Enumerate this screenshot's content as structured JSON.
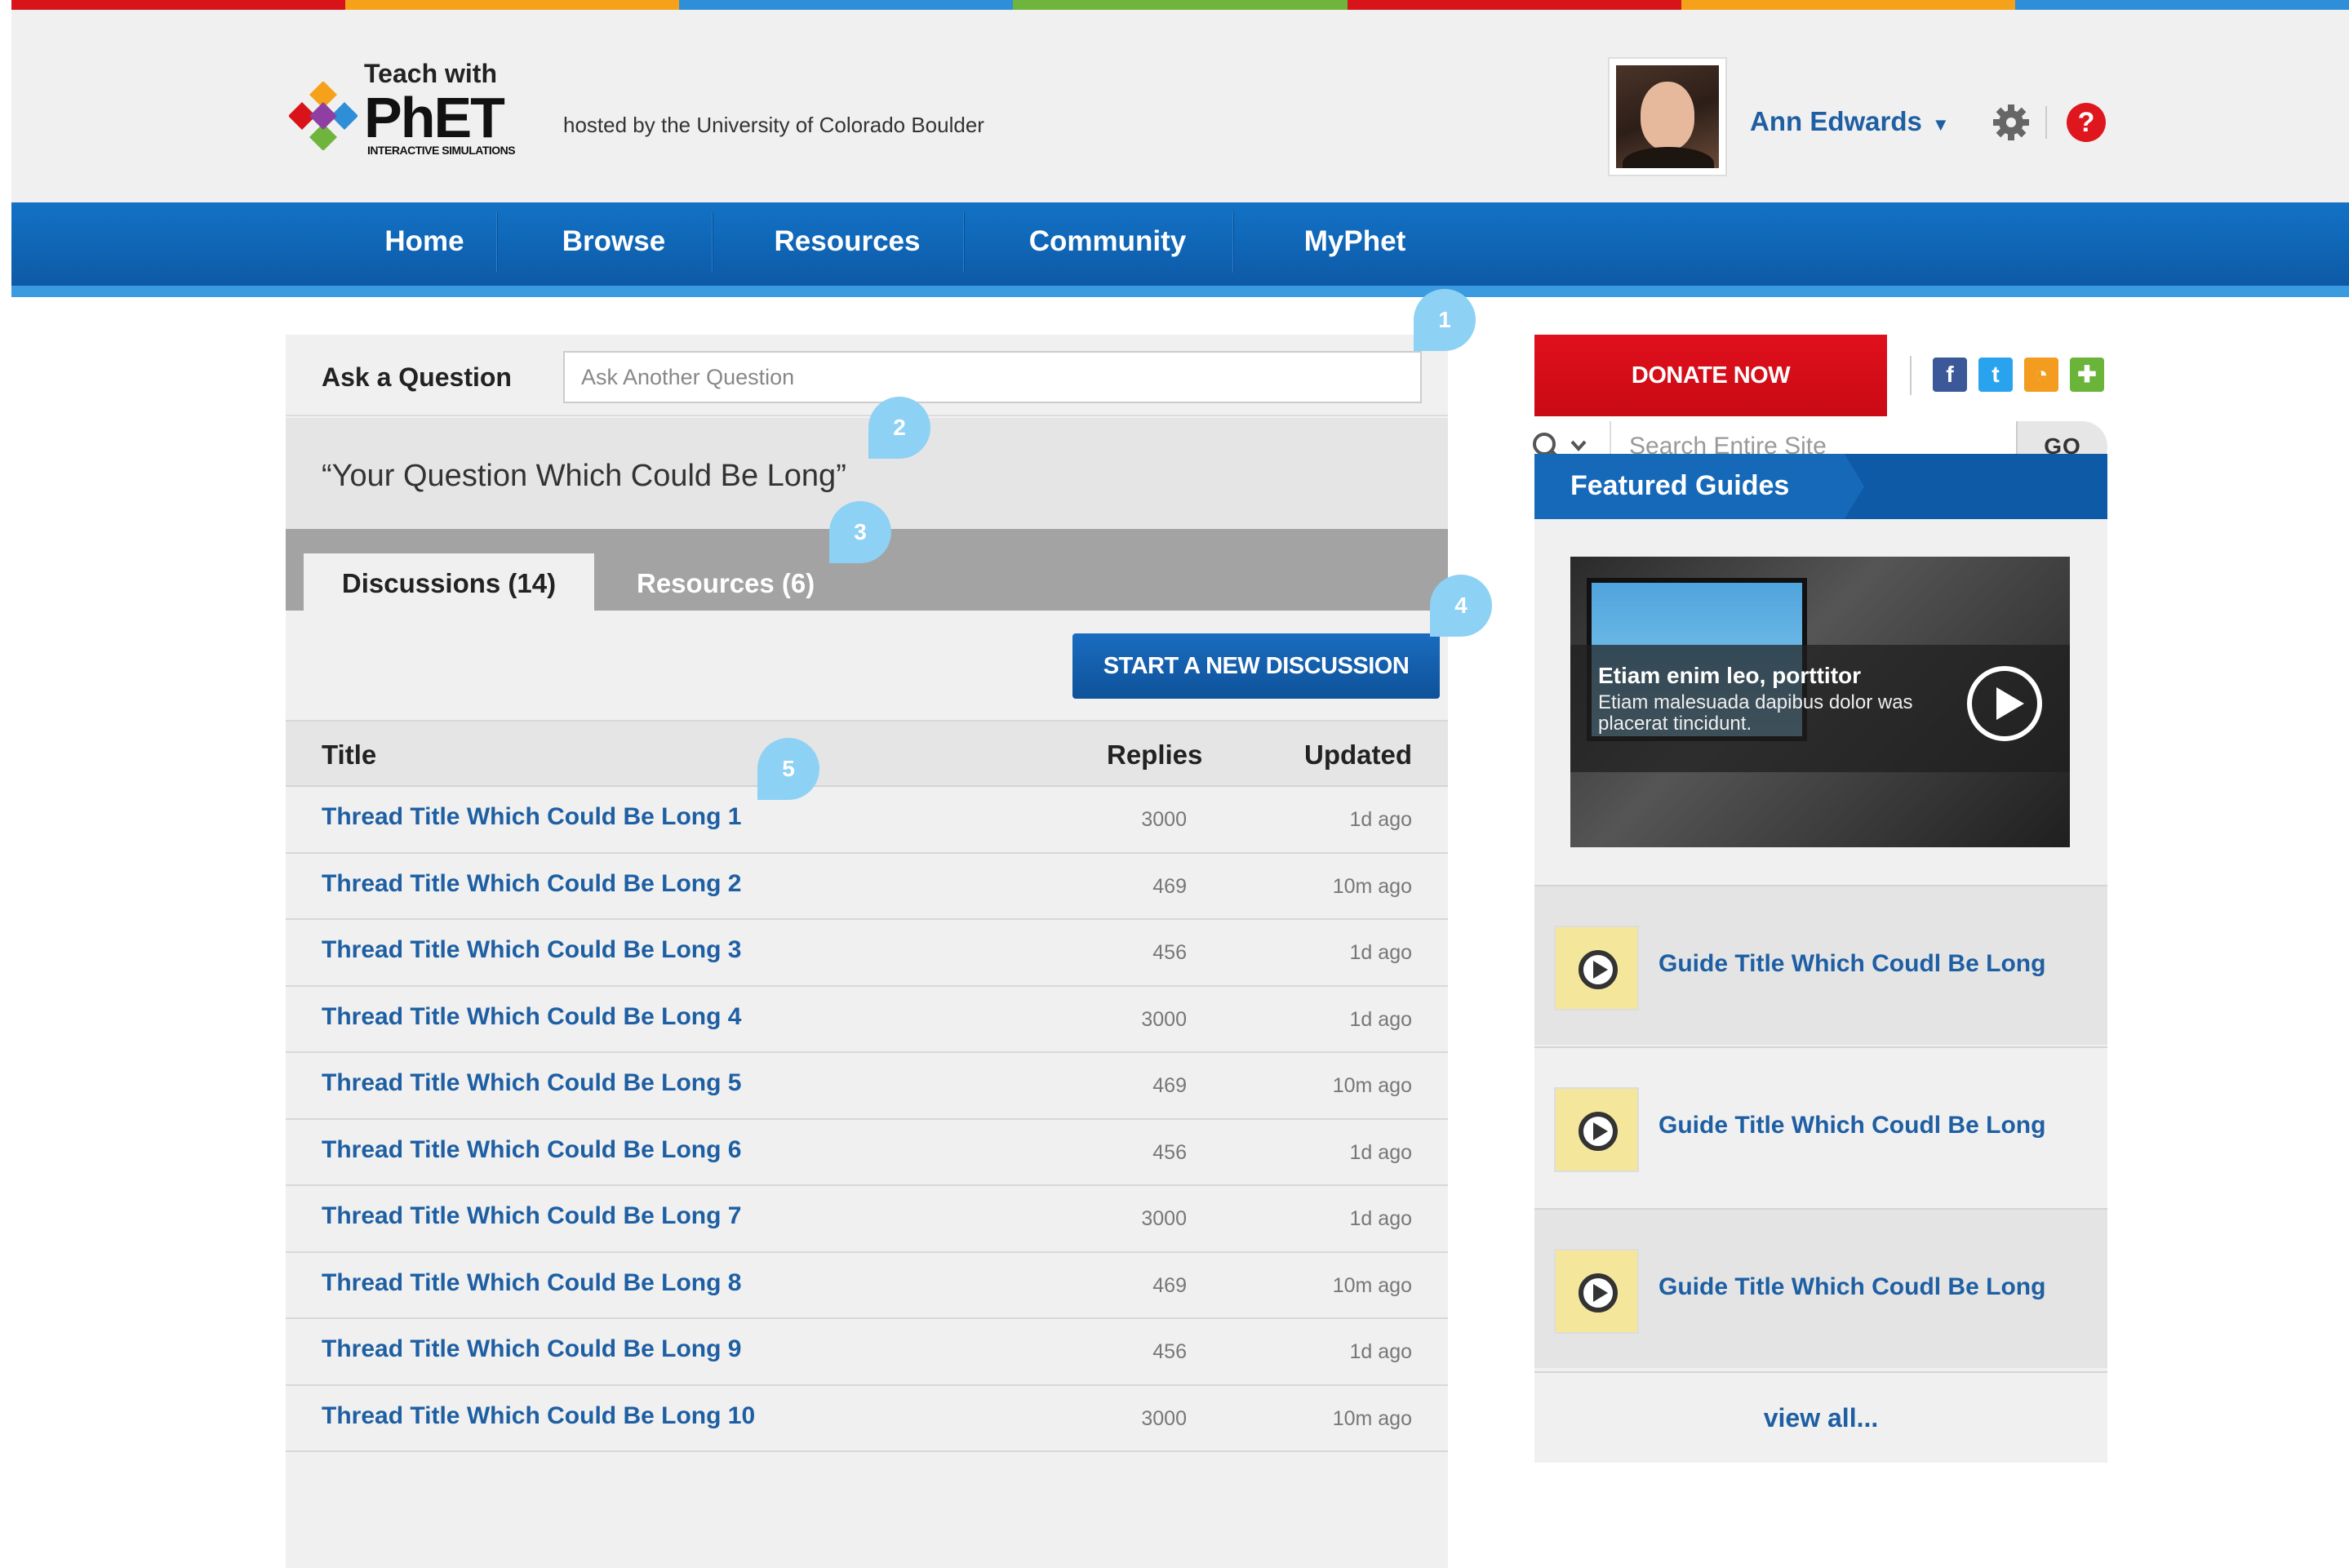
{
  "colors": {
    "colorbar": [
      "#d8131a",
      "#f5a21a",
      "#2e8ed8",
      "#6fb43d",
      "#d8131a",
      "#f5a21a",
      "#2e8ed8"
    ],
    "link": "#1e5fa3",
    "nav": "#0d5aa6",
    "donate": "#d80e18",
    "annotation_pin": "#8dd1f4"
  },
  "header": {
    "logo_teach": "Teach with",
    "logo_brand": "PhET",
    "logo_sub": "INTERACTIVE SIMULATIONS",
    "hosted": "hosted by the University of Colorado Boulder",
    "user_name": "Ann Edwards",
    "user_caret": "▼",
    "help_icon_text": "?"
  },
  "nav": {
    "items": [
      "Home",
      "Browse",
      "Resources",
      "Community",
      "MyPhet"
    ],
    "search_placeholder": "Search Entire Site",
    "search_go": "GO"
  },
  "main": {
    "ask_label": "Ask a Question",
    "ask_placeholder": "Ask Another Question",
    "question": "“Your Question Which Could Be Long”",
    "tabs": [
      {
        "label": "Discussions (14)",
        "active": true
      },
      {
        "label": "Resources (6)",
        "active": false
      }
    ],
    "start_button": "START A NEW DISCUSSION",
    "table": {
      "headers": [
        "Title",
        "Replies",
        "Updated"
      ],
      "rows": [
        {
          "title": "Thread Title Which Could Be Long 1",
          "replies": "3000",
          "updated": "1d ago"
        },
        {
          "title": "Thread Title Which Could Be Long 2",
          "replies": "469",
          "updated": "10m ago"
        },
        {
          "title": "Thread Title Which Could Be Long 3",
          "replies": "456",
          "updated": "1d ago"
        },
        {
          "title": "Thread Title Which Could Be Long 4",
          "replies": "3000",
          "updated": "1d ago"
        },
        {
          "title": "Thread Title Which Could Be Long 5",
          "replies": "469",
          "updated": "10m ago"
        },
        {
          "title": "Thread Title Which Could Be Long 6",
          "replies": "456",
          "updated": "1d ago"
        },
        {
          "title": "Thread Title Which Could Be Long 7",
          "replies": "3000",
          "updated": "1d ago"
        },
        {
          "title": "Thread Title Which Could Be Long 8",
          "replies": "469",
          "updated": "10m ago"
        },
        {
          "title": "Thread Title Which Could Be Long 9",
          "replies": "456",
          "updated": "1d ago"
        },
        {
          "title": "Thread Title Which Could Be Long 10",
          "replies": "3000",
          "updated": "10m ago"
        }
      ]
    }
  },
  "annotations": [
    "1",
    "2",
    "3",
    "4",
    "5"
  ],
  "sidebar": {
    "donate": "DONATE NOW",
    "social": [
      {
        "icon": "facebook-icon",
        "glyph": "f",
        "color": "#3b5998"
      },
      {
        "icon": "twitter-icon",
        "glyph": "t",
        "color": "#2aa3ef"
      },
      {
        "icon": "rss-icon",
        "glyph": "◔",
        "color": "#f39c20"
      },
      {
        "icon": "plus-icon",
        "glyph": "✚",
        "color": "#6ab43a"
      }
    ],
    "featured_title": "Featured Guides",
    "video": {
      "title": "Etiam enim leo, porttitor",
      "subtitle": "Etiam malesuada dapibus dolor was placerat tincidunt."
    },
    "guides": [
      "Guide Title Which Coudl Be Long",
      "Guide Title Which Coudl Be Long",
      "Guide Title Which Coudl Be Long"
    ],
    "view_all": "view all..."
  }
}
